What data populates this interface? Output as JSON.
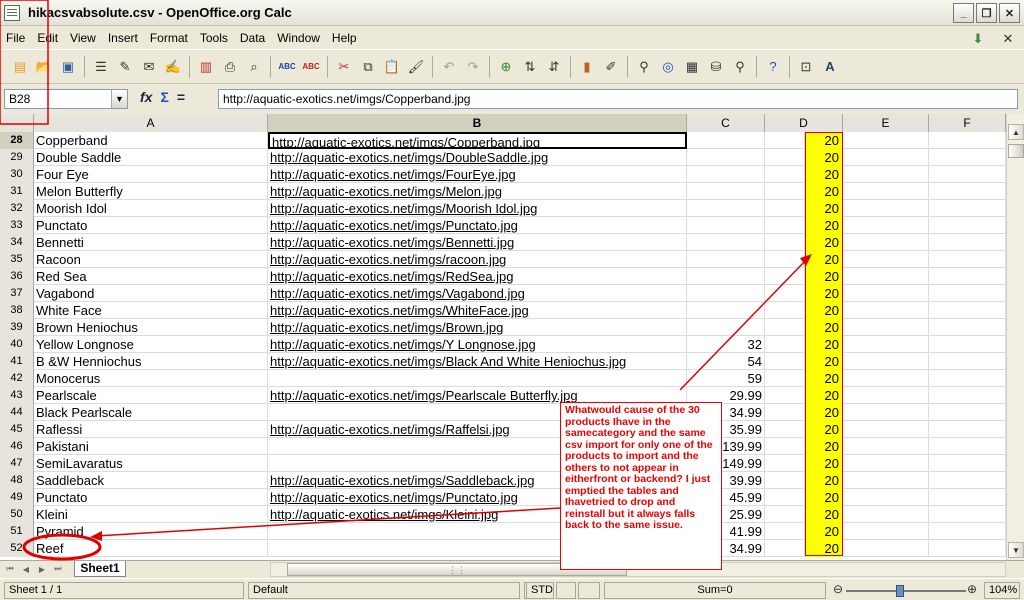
{
  "window": {
    "title": "hikacsvabsolute.csv - OpenOffice.org Calc"
  },
  "menu": [
    "File",
    "Edit",
    "View",
    "Insert",
    "Format",
    "Tools",
    "Data",
    "Window",
    "Help"
  ],
  "formula": {
    "cell_ref": "B28",
    "fx": "fx",
    "sum": "Σ",
    "eq": "=",
    "content": "http://aquatic-exotics.net/imgs/Copperband.jpg"
  },
  "columns": [
    "A",
    "B",
    "C",
    "D",
    "E",
    "F"
  ],
  "rows": [
    {
      "n": "28",
      "a": "Copperband",
      "b": "http://aquatic-exotics.net/imgs/Copperband.jpg",
      "c": "",
      "d": "20"
    },
    {
      "n": "29",
      "a": "Double Saddle",
      "b": "http://aquatic-exotics.net/imgs/DoubleSaddle.jpg",
      "c": "",
      "d": "20"
    },
    {
      "n": "30",
      "a": "Four Eye",
      "b": "http://aquatic-exotics.net/imgs/FourEye.jpg",
      "c": "",
      "d": "20"
    },
    {
      "n": "31",
      "a": "Melon Butterfly",
      "b": "http://aquatic-exotics.net/imgs/Melon.jpg",
      "c": "",
      "d": "20"
    },
    {
      "n": "32",
      "a": "Moorish Idol",
      "b": "http://aquatic-exotics.net/imgs/Moorish  Idol.jpg",
      "c": "",
      "d": "20"
    },
    {
      "n": "33",
      "a": "Punctato",
      "b": "http://aquatic-exotics.net/imgs/Punctato.jpg",
      "c": "",
      "d": "20"
    },
    {
      "n": "34",
      "a": "Bennetti",
      "b": "http://aquatic-exotics.net/imgs/Bennetti.jpg",
      "c": "",
      "d": "20"
    },
    {
      "n": "35",
      "a": "Racoon",
      "b": "http://aquatic-exotics.net/imgs/racoon.jpg",
      "c": "",
      "d": "20"
    },
    {
      "n": "36",
      "a": "Red Sea",
      "b": "http://aquatic-exotics.net/imgs/RedSea.jpg",
      "c": "",
      "d": "20"
    },
    {
      "n": "37",
      "a": "Vagabond",
      "b": "http://aquatic-exotics.net/imgs/Vagabond.jpg",
      "c": "",
      "d": "20"
    },
    {
      "n": "38",
      "a": "White Face",
      "b": "http://aquatic-exotics.net/imgs/WhiteFace.jpg",
      "c": "",
      "d": "20"
    },
    {
      "n": "39",
      "a": "Brown Heniochus",
      "b": "http://aquatic-exotics.net/imgs/Brown.jpg",
      "c": "",
      "d": "20"
    },
    {
      "n": "40",
      "a": "Yellow Longnose",
      "b": "http://aquatic-exotics.net/imgs/Y  Longnose.jpg",
      "c": "32",
      "d": "20"
    },
    {
      "n": "41",
      "a": "B &W Henniochus",
      "b": "http://aquatic-exotics.net/imgs/Black  And White Heniochus.jpg",
      "c": "54",
      "d": "20"
    },
    {
      "n": "42",
      "a": "Monocerus",
      "b": "",
      "c": "59",
      "d": "20"
    },
    {
      "n": "43",
      "a": "Pearlscale",
      "b": "http://aquatic-exotics.net/imgs/Pearlscale  Butterfly.jpg",
      "c": "29.99",
      "d": "20"
    },
    {
      "n": "44",
      "a": "Black Pearlscale",
      "b": "",
      "c": "34.99",
      "d": "20"
    },
    {
      "n": "45",
      "a": "Raflessi",
      "b": "http://aquatic-exotics.net/imgs/Raffelsi.jpg",
      "c": "35.99",
      "d": "20"
    },
    {
      "n": "46",
      "a": "Pakistani",
      "b": "",
      "c": "139.99",
      "d": "20"
    },
    {
      "n": "47",
      "a": "SemiLavaratus",
      "b": "",
      "c": "149.99",
      "d": "20"
    },
    {
      "n": "48",
      "a": "Saddleback",
      "b": "http://aquatic-exotics.net/imgs/Saddleback.jpg",
      "c": "39.99",
      "d": "20"
    },
    {
      "n": "49",
      "a": "Punctato",
      "b": "http://aquatic-exotics.net/imgs/Punctato.jpg",
      "c": "45.99",
      "d": "20"
    },
    {
      "n": "50",
      "a": "Kleini",
      "b": "http://aquatic-exotics.net/imgs/Kleini.jpg",
      "c": "25.99",
      "d": "20"
    },
    {
      "n": "51",
      "a": "Pyramid",
      "b": "",
      "c": "41.99",
      "d": "20"
    },
    {
      "n": "52",
      "a": "Reef",
      "b": "",
      "c": "34.99",
      "d": "20"
    }
  ],
  "sheet_tab": "Sheet1",
  "status": {
    "sheet": "Sheet 1 / 1",
    "style": "Default",
    "mode": "STD",
    "sum": "Sum=0",
    "zoom": "104%"
  },
  "annotation": "Whatwould cause of the 30 products Ihave in the samecategory and the same csv import for only one of the products to import and the others to not appear in eitherfront or backend? I just emptied the tables and Ihavetried to drop and reinstall but it always falls back to the same issue.",
  "colors": {
    "highlight": "#ffff00",
    "annotation": "#e00000"
  }
}
